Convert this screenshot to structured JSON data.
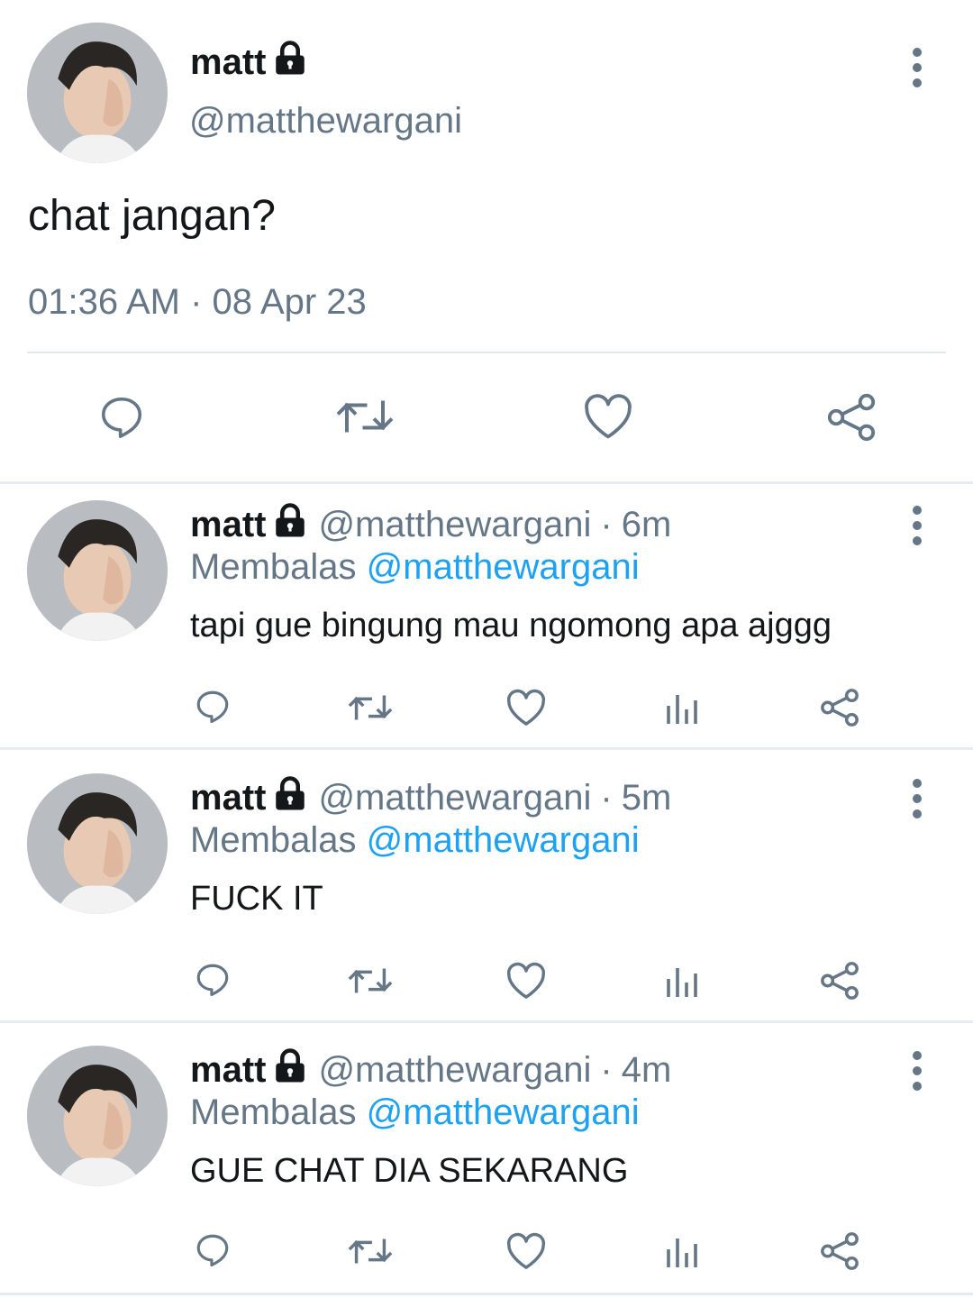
{
  "main_tweet": {
    "name": "matt",
    "handle": "@matthewargani",
    "text": "chat jangan?",
    "timestamp": "01:36 AM · 08 Apr 23",
    "actions": [
      "reply-icon",
      "retweet-icon",
      "like-icon",
      "share-icon"
    ]
  },
  "replies": [
    {
      "name": "matt",
      "handle": "@matthewargani",
      "separator": "·",
      "ago": "6m",
      "replying_prefix": "Membalas",
      "replying_to": "@matthewargani",
      "text": "tapi gue bingung mau ngomong apa ajggg"
    },
    {
      "name": "matt",
      "handle": "@matthewargani",
      "separator": "·",
      "ago": "5m",
      "replying_prefix": "Membalas",
      "replying_to": "@matthewargani",
      "text": "FUCK IT"
    },
    {
      "name": "matt",
      "handle": "@matthewargani",
      "separator": "·",
      "ago": "4m",
      "replying_prefix": "Membalas",
      "replying_to": "@matthewargani",
      "text": "GUE CHAT DIA SEKARANG"
    }
  ],
  "colors": {
    "text": "#14171a",
    "secondary": "#657786",
    "link": "#1da1f2",
    "divider": "#e1e8ed"
  }
}
